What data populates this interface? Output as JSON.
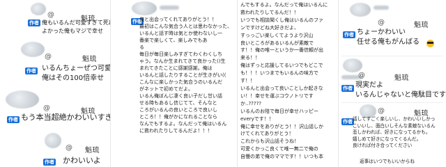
{
  "author_badge": "作者",
  "at_sign": "@",
  "username": "魁琉",
  "col1": {
    "m1": "俺もいるんだ可愛すぎて死にそう\nよかった俺もマジで幸せ",
    "m2": "いるんちょーぜつ可愛いよ？\n俺はその100倍幸せ",
    "m3": "もう本当超絶かわいいすぎ",
    "m4": "かわいいよ"
  },
  "col2": {
    "m1": "俺と出会ってくれてありがとう！！\n最初はこんな気合う人とは思わなかった、\nいるんと話す時は気とか使わないし一\n番楽で楽しくて、楽しみでもあ\nる\n毎日が毎日楽しみすぎてわくわくしち\nゃう。なんか生まれてきて良かった()生\nまれてきたことに感謝感謝。俺は\nいるんと話したりすることが生きがい((\nこんなに楽しかった気合うのいるんだ\nがネットで初めてだよ。\nいるん俺ぼんじ凄く良い子だし甘い話\nせる時もあるし信じてて、そんなと\nころがいるんの良いところで良いし\nところ！！俺がかになれることなら\nなんでもするよ。なんだって俺はいるん\nに救われたりしてるんだよ！！！"
  },
  "col3": {
    "m1": "んでもするよ。なんだって俺はいるんに\n救われたりしてるんだ！！\nいつでも相談聞くし俺はいるんのファ\nンですけどね大好きだよ、\nすっっごい楽しくてようより沢山\n良いところがあるいるんが素敵で\nす！！俺の唯一というか一番信頼が出\n来る！！\n俺はずっと応援してるいつでもどこで\nも！！！いつまでもいるんの味方で\nす！！\nいるんと出会って良いことしか起きな\nい！！幸せを運ぶコウノトリです\nか..?????\nいるんのお陰で毎日が幸せハッピー\neveryです！！\n俺に幸せをありがとう！！沢山話しか\nけてくれてありがとう！\nこれからも沢山話そうね！\n可愛くかっこ良くて唯一無二で俺の\n自慢の弟で俺のママです！！いつも本"
  },
  "col4": {
    "m1": "ちょーかわいい\n任せる俺もがんばる",
    "m2": "現実だよ\nいるんじゃないと俺駄目です",
    "m3": "話してすごく楽しいし、かわいいしかっ\nこいいし、面白いしそんな素敵ないるん\n悲しかわれば、好きになってるかも。\n嬉しめて好きになってくるんだ。\n良ければ付き合ってください",
    "m4": "返事はいつでもいいからね"
  },
  "colors": {
    "badge": "#1a6fd8",
    "text": "#1e1e1e"
  },
  "icons": [
    "sunglasses-emoji-icon",
    "avatar-icon"
  ]
}
